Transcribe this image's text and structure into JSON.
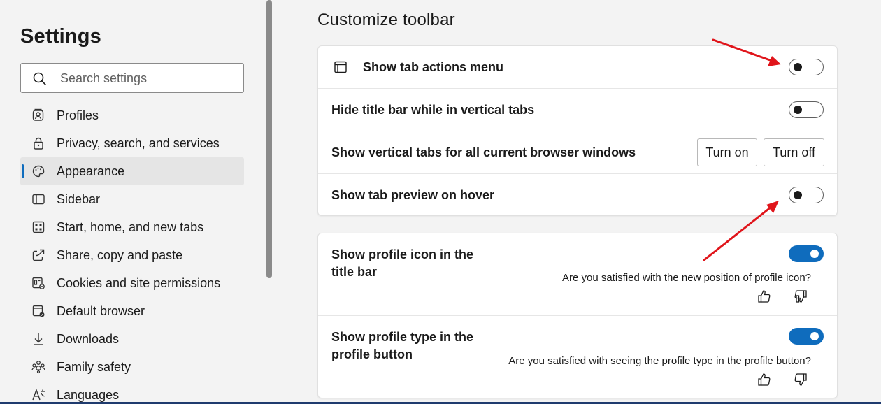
{
  "sidebar": {
    "title": "Settings",
    "search_placeholder": "Search settings",
    "items": [
      {
        "label": "Profiles",
        "icon": "profiles-icon"
      },
      {
        "label": "Privacy, search, and services",
        "icon": "lock-icon"
      },
      {
        "label": "Appearance",
        "icon": "palette-icon",
        "active": true
      },
      {
        "label": "Sidebar",
        "icon": "sidebar-icon"
      },
      {
        "label": "Start, home, and new tabs",
        "icon": "home-tabs-icon"
      },
      {
        "label": "Share, copy and paste",
        "icon": "share-icon"
      },
      {
        "label": "Cookies and site permissions",
        "icon": "cookies-icon"
      },
      {
        "label": "Default browser",
        "icon": "default-browser-icon"
      },
      {
        "label": "Downloads",
        "icon": "download-icon"
      },
      {
        "label": "Family safety",
        "icon": "family-icon"
      },
      {
        "label": "Languages",
        "icon": "languages-icon"
      }
    ]
  },
  "main": {
    "section_title": "Customize toolbar",
    "card1": {
      "rows": [
        {
          "label": "Show tab actions menu",
          "toggle": false,
          "icon": "tab-actions-icon"
        },
        {
          "label": "Hide title bar while in vertical tabs",
          "toggle": false
        },
        {
          "label": "Show vertical tabs for all current browser windows",
          "buttons": [
            "Turn on",
            "Turn off"
          ]
        },
        {
          "label": "Show tab preview on hover",
          "toggle": false
        }
      ]
    },
    "card2": {
      "rows": [
        {
          "label": "Show profile icon in the title bar",
          "toggle": true,
          "question": "Are you satisfied with the new position of profile icon?"
        },
        {
          "label": "Show profile type in the profile button",
          "toggle": true,
          "question": "Are you satisfied with seeing the profile type in the profile button?"
        }
      ]
    }
  },
  "colors": {
    "accent": "#0f6cbd",
    "annotation_arrow": "#e0151b",
    "background": "#f3f3f3"
  }
}
